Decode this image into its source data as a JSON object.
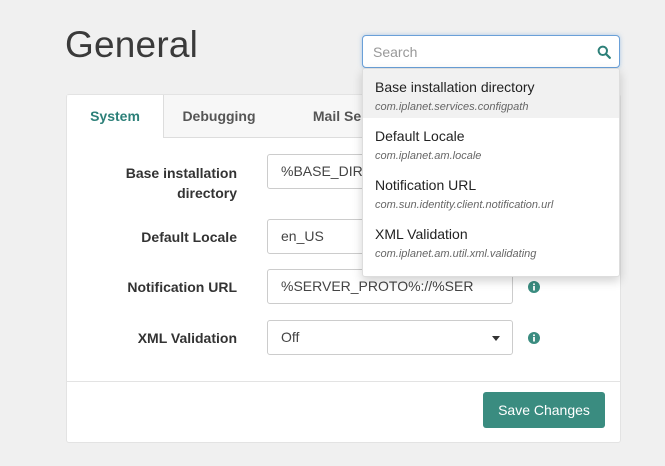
{
  "page": {
    "title": "General"
  },
  "search": {
    "placeholder": "Search",
    "value": ""
  },
  "tabs": [
    {
      "label": "System",
      "active": true
    },
    {
      "label": "Debugging",
      "active": false
    },
    {
      "label": "Mail Se",
      "active": false
    }
  ],
  "fields": [
    {
      "label_line1": "Base installation",
      "label_line2": "directory",
      "value": "%BASE_DIR%"
    },
    {
      "label": "Default Locale",
      "value": "en_US"
    },
    {
      "label": "Notification URL",
      "value": "%SERVER_PROTO%://%SER"
    },
    {
      "label": "XML Validation",
      "value": "Off"
    }
  ],
  "footer": {
    "save_label": "Save Changes"
  },
  "dropdown": {
    "items": [
      {
        "title": "Base installation directory",
        "subtitle": "com.iplanet.services.configpath",
        "highlighted": true
      },
      {
        "title": "Default Locale",
        "subtitle": "com.iplanet.am.locale",
        "highlighted": false
      },
      {
        "title": "Notification URL",
        "subtitle": "com.sun.identity.client.notification.url",
        "highlighted": false
      },
      {
        "title": "XML Validation",
        "subtitle": "com.iplanet.am.util.xml.validating",
        "highlighted": false
      }
    ]
  },
  "colors": {
    "accent": "#2d8079",
    "save_button": "#3a8c80",
    "search_focus": "#6aa0d8"
  },
  "icons": {
    "search": "search-icon",
    "info": "info-icon",
    "caret": "chevron-down-icon"
  }
}
